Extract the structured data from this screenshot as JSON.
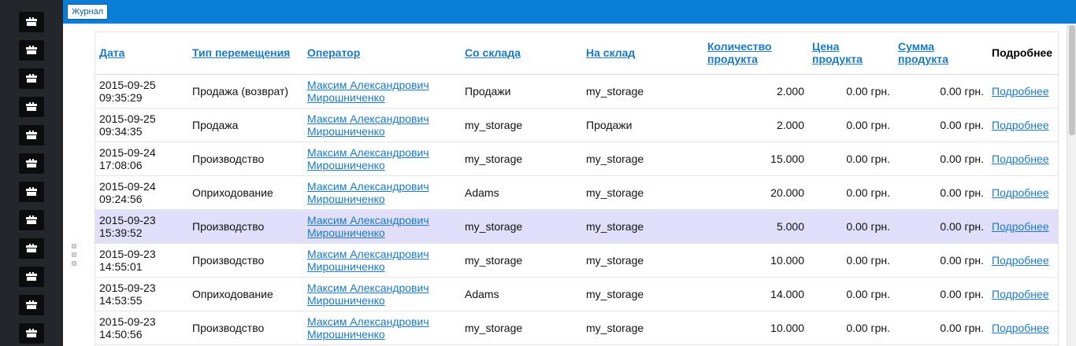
{
  "toolbar": {
    "journal_label": "Журнал"
  },
  "sidebar": {
    "buttons": [
      "box-icon",
      "box-icon",
      "box-icon",
      "box-icon",
      "box-icon",
      "box-icon",
      "box-icon",
      "box-icon",
      "box-icon",
      "box-icon",
      "box-icon",
      "box-icon"
    ]
  },
  "table": {
    "headers": {
      "date": "Дата",
      "move_type": "Тип перемещения",
      "operator": "Оператор",
      "from_storage": "Со склада",
      "to_storage": "На склад",
      "qty": "Количество продукта",
      "price": "Цена продукта",
      "sum": "Сумма продукта",
      "details": "Подробнее"
    },
    "rows": [
      {
        "date1": "2015-09-25",
        "date2": "09:35:29",
        "type": "Продажа (возврат)",
        "op1": "Максим Александрович",
        "op2": "Мирошниченко",
        "from": "Продажи",
        "to": "my_storage",
        "qty": "2.000",
        "price": "0.00 грн.",
        "sum": "0.00 грн.",
        "details": "Подробнее"
      },
      {
        "date1": "2015-09-25",
        "date2": "09:34:35",
        "type": "Продажа",
        "op1": "Максим Александрович",
        "op2": "Мирошниченко",
        "from": "my_storage",
        "to": "Продажи",
        "qty": "2.000",
        "price": "0.00 грн.",
        "sum": "0.00 грн.",
        "details": "Подробнее"
      },
      {
        "date1": "2015-09-24",
        "date2": "17:08:06",
        "type": "Производство",
        "op1": "Максим Александрович",
        "op2": "Мирошниченко",
        "from": "my_storage",
        "to": "my_storage",
        "qty": "15.000",
        "price": "0.00 грн.",
        "sum": "0.00 грн.",
        "details": "Подробнее"
      },
      {
        "date1": "2015-09-24",
        "date2": "09:24:56",
        "type": "Оприходование",
        "op1": "Максим Александрович",
        "op2": "Мирошниченко",
        "from": "Adams",
        "to": "my_storage",
        "qty": "20.000",
        "price": "0.00 грн.",
        "sum": "0.00 грн.",
        "details": "Подробнее"
      },
      {
        "date1": "2015-09-23",
        "date2": "15:39:52",
        "type": "Производство",
        "op1": "Максим Александрович",
        "op2": "Мирошниченко",
        "from": "my_storage",
        "to": "my_storage",
        "qty": "5.000",
        "price": "0.00 грн.",
        "sum": "0.00 грн.",
        "details": "Подробнее"
      },
      {
        "date1": "2015-09-23",
        "date2": "14:55:01",
        "type": "Производство",
        "op1": "Максим Александрович",
        "op2": "Мирошниченко",
        "from": "my_storage",
        "to": "my_storage",
        "qty": "10.000",
        "price": "0.00 грн.",
        "sum": "0.00 грн.",
        "details": "Подробнее"
      },
      {
        "date1": "2015-09-23",
        "date2": "14:53:55",
        "type": "Оприходование",
        "op1": "Максим Александрович",
        "op2": "Мирошниченко",
        "from": "Adams",
        "to": "my_storage",
        "qty": "14.000",
        "price": "0.00 грн.",
        "sum": "0.00 грн.",
        "details": "Подробнее"
      },
      {
        "date1": "2015-09-23",
        "date2": "14:50:56",
        "type": "Производство",
        "op1": "Максим Александрович",
        "op2": "Мирошниченко",
        "from": "my_storage",
        "to": "my_storage",
        "qty": "10.000",
        "price": "0.00 грн.",
        "sum": "0.00 грн.",
        "details": "Подробнее"
      }
    ],
    "highlighted_row": 4
  },
  "colors": {
    "topbar": "#0a7ed6",
    "sidebar": "#23262b",
    "link": "#1a7abf",
    "highlight": "#e1defa"
  }
}
